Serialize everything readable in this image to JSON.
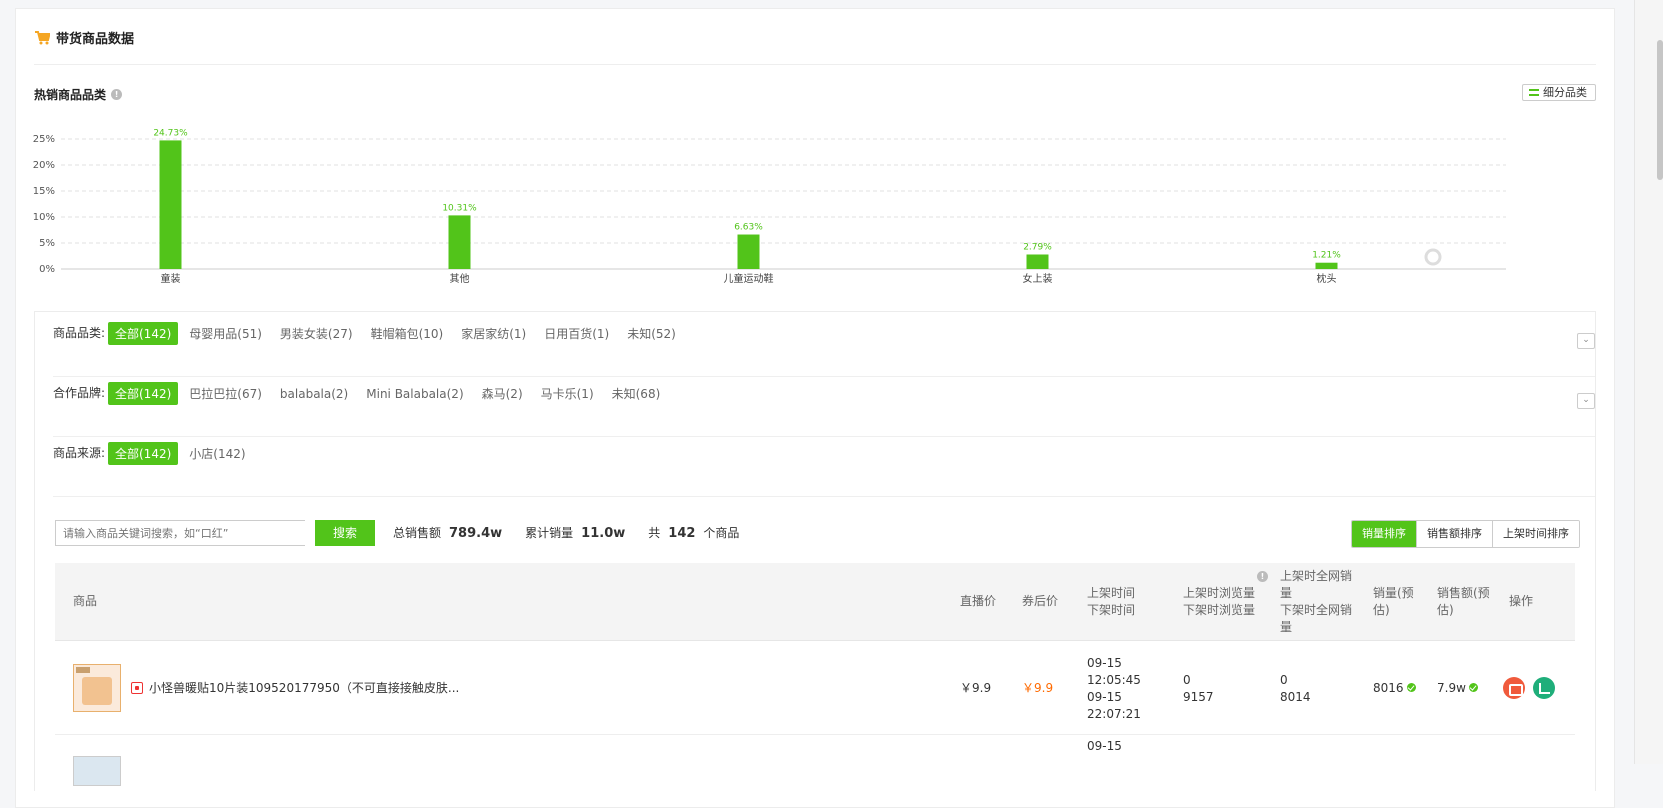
{
  "section": {
    "title": "带货商品数据"
  },
  "hot": {
    "title": "热销商品品类",
    "breakdown_button": "细分品类"
  },
  "chart_data": {
    "type": "bar",
    "categories": [
      "童装",
      "其他",
      "儿童运动鞋",
      "女上装",
      "枕头"
    ],
    "values": [
      24.73,
      10.31,
      6.63,
      2.79,
      1.21
    ],
    "value_labels": [
      "24.73%",
      "10.31%",
      "6.63%",
      "2.79%",
      "1.21%"
    ],
    "yticks": [
      "0%",
      "5%",
      "10%",
      "15%",
      "20%",
      "25%"
    ],
    "ylim": [
      0,
      25
    ],
    "grid": true,
    "bar_color": "#52c41a",
    "title": "",
    "xlabel": "",
    "ylabel": ""
  },
  "filters": [
    {
      "label": "商品品类:",
      "options": [
        "全部(142)",
        "母婴用品(51)",
        "男装女装(27)",
        "鞋帽箱包(10)",
        "家居家纺(1)",
        "日用百货(1)",
        "未知(52)"
      ]
    },
    {
      "label": "合作品牌:",
      "options": [
        "全部(142)",
        "巴拉巴拉(67)",
        "balabala(2)",
        "Mini Balabala(2)",
        "森马(2)",
        "马卡乐(1)",
        "未知(68)"
      ]
    },
    {
      "label": "商品来源:",
      "options": [
        "全部(142)",
        "小店(142)"
      ]
    }
  ],
  "search": {
    "placeholder": "请输入商品关键词搜索，如“口红”",
    "button": "搜索"
  },
  "stats": {
    "sales_label": "总销售额",
    "sales_value": "789.4w",
    "volume_label": "累计销量",
    "volume_value": "11.0w",
    "count_prefix": "共",
    "count_value": "142",
    "count_suffix": "个商品"
  },
  "sort": [
    "销量排序",
    "销售额排序",
    "上架时间排序"
  ],
  "table": {
    "headers": {
      "product": "商品",
      "live_price": "直播价",
      "coupon_price": "券后价",
      "time": "上架时间\n下架时间",
      "views": "上架时浏览量\n下架时浏览量",
      "net_sales": "上架时全网销量\n下架时全网销量",
      "sales": "销量(预估)",
      "revenue": "销售额(预估)",
      "action": "操作"
    },
    "rows": [
      {
        "name": "小怪兽暖贴10片装109520177950（不可直接接触皮肤...",
        "live_price": "￥9.9",
        "coupon_price": "￥9.9",
        "time": "09-15\n12:05:45\n09-15\n22:07:21",
        "views": "0\n9157",
        "net_sales": "0\n8014",
        "sales": "8016",
        "revenue": "7.9w"
      },
      {
        "time_partial": "09-15"
      }
    ]
  }
}
